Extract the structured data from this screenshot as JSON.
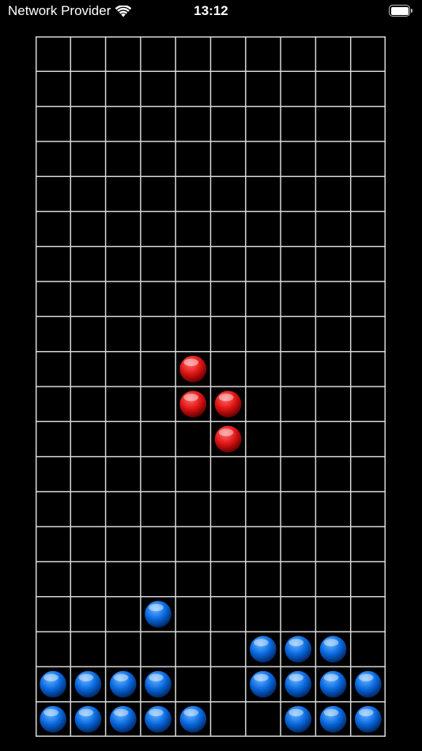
{
  "status_bar": {
    "carrier": "Network Provider",
    "time": "13:12",
    "wifi_icon": "wifi-icon",
    "battery_icon": "battery-icon"
  },
  "board": {
    "columns": 10,
    "rows": 20,
    "background_color": "#000000",
    "grid_color": "#d9d9d9",
    "active_piece": {
      "color": "red",
      "cells": [
        [
          4,
          9
        ],
        [
          4,
          10
        ],
        [
          5,
          10
        ],
        [
          5,
          11
        ]
      ]
    },
    "locked_blocks": {
      "color": "blue",
      "cells": [
        [
          3,
          16
        ],
        [
          6,
          17
        ],
        [
          7,
          17
        ],
        [
          8,
          17
        ],
        [
          0,
          18
        ],
        [
          1,
          18
        ],
        [
          2,
          18
        ],
        [
          3,
          18
        ],
        [
          6,
          18
        ],
        [
          7,
          18
        ],
        [
          8,
          18
        ],
        [
          9,
          18
        ],
        [
          0,
          19
        ],
        [
          1,
          19
        ],
        [
          2,
          19
        ],
        [
          3,
          19
        ],
        [
          4,
          19
        ],
        [
          7,
          19
        ],
        [
          8,
          19
        ],
        [
          9,
          19
        ]
      ]
    }
  },
  "colors": {
    "red_light": "#ff6a6a",
    "red_mid": "#e01515",
    "red_dark": "#6a0000",
    "blue_light": "#6ab6ff",
    "blue_mid": "#0a6ae0",
    "blue_dark": "#002a6a"
  }
}
